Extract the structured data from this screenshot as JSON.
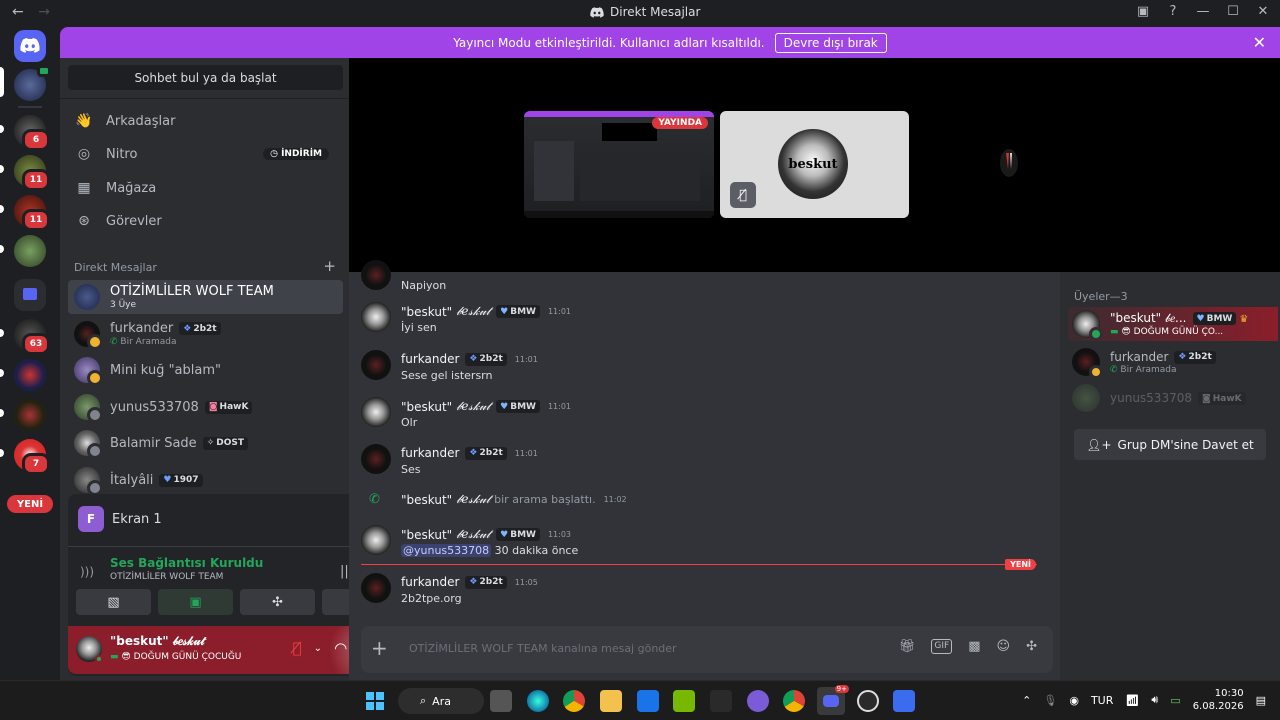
{
  "window": {
    "title": "Direkt Mesajlar",
    "back": "←",
    "forward": "→"
  },
  "guilds": {
    "badges": [
      "6",
      "11",
      "11",
      "63",
      "7"
    ],
    "new_label": "YENİ"
  },
  "banner": {
    "text": "Yayıncı Modu etkinleştirildi. Kullanıcı adları kısaltıldı.",
    "button": "Devre dışı bırak",
    "close": "✕"
  },
  "sidebar": {
    "search": "Sohbet bul ya da başlat",
    "nav": [
      {
        "label": "Arkadaşlar",
        "icon": "friends-icon"
      },
      {
        "label": "Nitro",
        "icon": "nitro-icon"
      },
      {
        "label": "Mağaza",
        "icon": "shop-icon"
      },
      {
        "label": "Görevler",
        "icon": "quests-icon"
      }
    ],
    "nitro_badge": "İNDİRİM",
    "dm_header": "Direkt Mesajlar",
    "dm_add": "+",
    "dms": [
      {
        "name": "OTİZİMLİLER WOLF TEAM",
        "sub": "3 Üye",
        "tag": ""
      },
      {
        "name": "furkander",
        "sub": "Bir Aramada",
        "tag": "2b2t"
      },
      {
        "name": "Mini kuğ \"ablam\"",
        "sub": "",
        "tag": ""
      },
      {
        "name": "yunus533708",
        "sub": "",
        "tag": "HawK"
      },
      {
        "name": "Balamir Sade",
        "sub": "",
        "tag": "DOST"
      },
      {
        "name": "İtalyâli",
        "sub": "",
        "tag": "1907"
      }
    ]
  },
  "rtc": {
    "screen_avatar": "F",
    "screen_label": "Ekran 1",
    "status": "Ses Bağlantısı Kuruldu",
    "channel": "OTİZİMLİLER WOLF TEAM"
  },
  "user": {
    "name": "\"beskut\" 𝒷𝑒𝓈𝓀𝓊𝓉",
    "status": "😎 DOĞUM GÜNÜ ÇOCUĞU"
  },
  "stage": {
    "live": "YAYINDA",
    "orb_text": "beskut"
  },
  "chat": {
    "first_line": "Napiyon",
    "messages": [
      {
        "author": "\"beskut\"",
        "fancy": "𝒷𝑒𝓈𝓀𝓊𝓉",
        "tag": "BMW",
        "time": "11:01",
        "body": "İyi sen"
      },
      {
        "author": "furkander",
        "fancy": "",
        "tag": "2b2t",
        "time": "11:01",
        "body": "Sese gel istersrn"
      },
      {
        "author": "\"beskut\"",
        "fancy": "𝒷𝑒𝓈𝓀𝓊𝓉",
        "tag": "BMW",
        "time": "11:01",
        "body": "Olr"
      },
      {
        "author": "furkander",
        "fancy": "",
        "tag": "2b2t",
        "time": "11:01",
        "body": "Ses"
      }
    ],
    "call": {
      "author": "\"beskut\"",
      "fancy": "𝒷𝑒𝓈𝓀𝓊𝓉",
      "text": "bir arama başlattı.",
      "time": "11:02"
    },
    "msg5": {
      "author": "\"beskut\"",
      "fancy": "𝒷𝑒𝓈𝓀𝓊𝓉",
      "tag": "BMW",
      "time": "11:03",
      "mention": "@yunus533708",
      "body": "30 dakika önce"
    },
    "new_label": "YENİ",
    "msg6": {
      "author": "furkander",
      "tag": "2b2t",
      "time": "11:05",
      "body": "2b2tpe.org"
    },
    "placeholder": "OTİZİMLİLER WOLF TEAM kanalına mesaj gönder"
  },
  "members": {
    "header": "Üyeler—3",
    "list": [
      {
        "name": "\"beskut\" 𝒷𝑒...",
        "tag": "BMW",
        "sub": "😎 DOĞUM GÜNÜ ÇO..."
      },
      {
        "name": "furkander",
        "tag": "2b2t",
        "sub": "Bir Aramada"
      },
      {
        "name": "yunus533708",
        "tag": "HawK",
        "sub": ""
      }
    ],
    "invite": "Grup DM'sine Davet et"
  },
  "taskbar": {
    "search": "Ara",
    "lang": "TUR",
    "time": "10:30",
    "date": "6.08.2026",
    "discord_badge": "9+"
  }
}
